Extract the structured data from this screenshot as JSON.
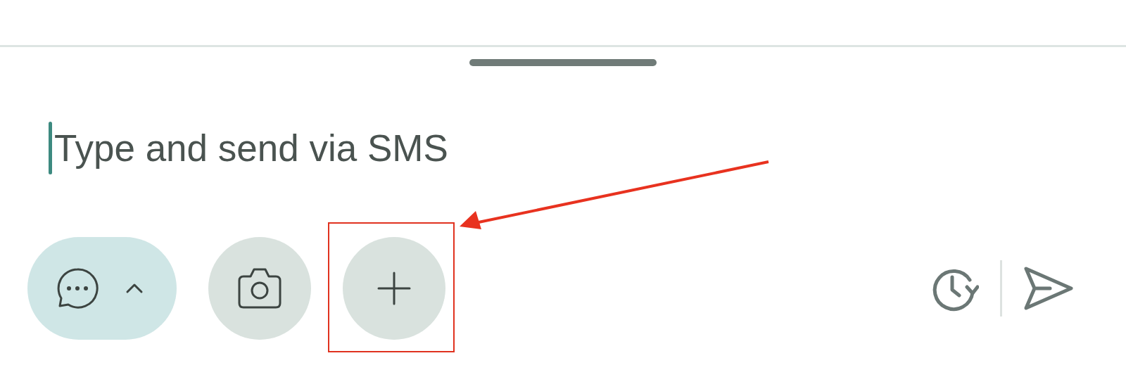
{
  "message_field": {
    "placeholder": "Type and send via SMS",
    "focused": true
  },
  "left_buttons": [
    {
      "kind": "message-type",
      "expanded": false
    },
    {
      "kind": "camera"
    },
    {
      "kind": "attach"
    }
  ],
  "right_buttons": [
    {
      "kind": "schedule"
    },
    {
      "kind": "send",
      "disabled": true
    }
  ]
}
